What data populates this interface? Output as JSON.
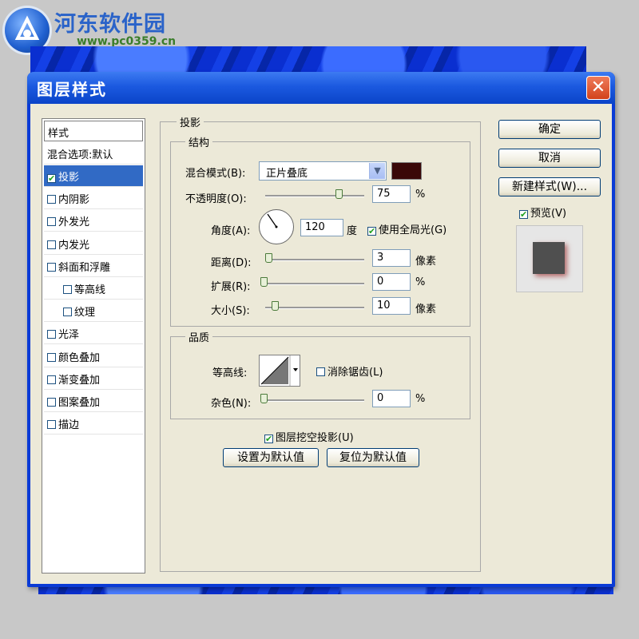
{
  "watermark": {
    "title": "河东软件园",
    "url": "www.pc0359.cn"
  },
  "dialog": {
    "title": "图层样式",
    "close_glyph": "✕",
    "styles_header": "样式",
    "blend_options": "混合选项:默认",
    "styles": [
      {
        "label": "投影",
        "checked": true,
        "selected": true
      },
      {
        "label": "内阴影",
        "checked": false
      },
      {
        "label": "外发光",
        "checked": false
      },
      {
        "label": "内发光",
        "checked": false
      },
      {
        "label": "斜面和浮雕",
        "checked": false
      },
      {
        "label": "等高线",
        "checked": false,
        "sub": true
      },
      {
        "label": "纹理",
        "checked": false,
        "sub": true
      },
      {
        "label": "光泽",
        "checked": false
      },
      {
        "label": "颜色叠加",
        "checked": false
      },
      {
        "label": "渐变叠加",
        "checked": false
      },
      {
        "label": "图案叠加",
        "checked": false
      },
      {
        "label": "描边",
        "checked": false
      }
    ],
    "section_title": "投影",
    "structure": {
      "legend": "结构",
      "blend_mode_label": "混合模式(B):",
      "blend_mode_value": "正片叠底",
      "blend_color": "#3a0808",
      "opacity_label": "不透明度(O):",
      "opacity_value": "75",
      "opacity_unit": "%",
      "angle_label": "角度(A):",
      "angle_value": "120",
      "angle_unit": "度",
      "global_light_label": "使用全局光(G)",
      "global_light_checked": true,
      "distance_label": "距离(D):",
      "distance_value": "3",
      "distance_unit": "像素",
      "spread_label": "扩展(R):",
      "spread_value": "0",
      "spread_unit": "%",
      "size_label": "大小(S):",
      "size_value": "10",
      "size_unit": "像素"
    },
    "quality": {
      "legend": "品质",
      "contour_label": "等高线:",
      "anti_alias_label": "消除锯齿(L)",
      "anti_alias_checked": false,
      "noise_label": "杂色(N):",
      "noise_value": "0",
      "noise_unit": "%"
    },
    "knockout_label": "图层挖空投影(U)",
    "knockout_checked": true,
    "make_default": "设置为默认值",
    "reset_default": "复位为默认值",
    "ok": "确定",
    "cancel": "取消",
    "new_style": "新建样式(W)...",
    "preview_label": "预览(V)",
    "preview_checked": true,
    "check_glyph": "✔"
  }
}
